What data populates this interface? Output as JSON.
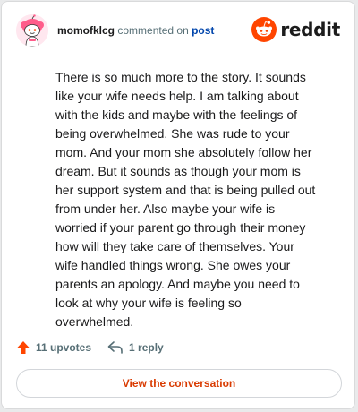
{
  "comment": {
    "username": "momofklcg",
    "action_text": "commented on",
    "post_link": "post",
    "body": "There is so much more to the story. It sounds like your wife needs help. I am talking about with the kids and maybe with the feelings of being overwhelmed. She was rude to your mom. And your mom she absolutely follow her dream. But it sounds as though your mom is her support system and that is being pulled out from under her. Also maybe your wife is worried if your parent go through their money how will they take care of themselves. Your wife handled things wrong. She owes your parents an apology. And maybe you need to look at why your wife is feeling so overwhelmed."
  },
  "brand": {
    "wordmark": "reddit",
    "accent_color": "#ff4500"
  },
  "actions": {
    "upvotes_label": "11 upvotes",
    "reply_label": "1 reply",
    "upvote_icon": "upvote-arrow-icon",
    "reply_icon": "reply-arrow-icon"
  },
  "cta": {
    "label": "View the conversation"
  },
  "icons": {
    "avatar": "snoo-avatar-icon",
    "logo": "reddit-snoo-logo-icon"
  }
}
